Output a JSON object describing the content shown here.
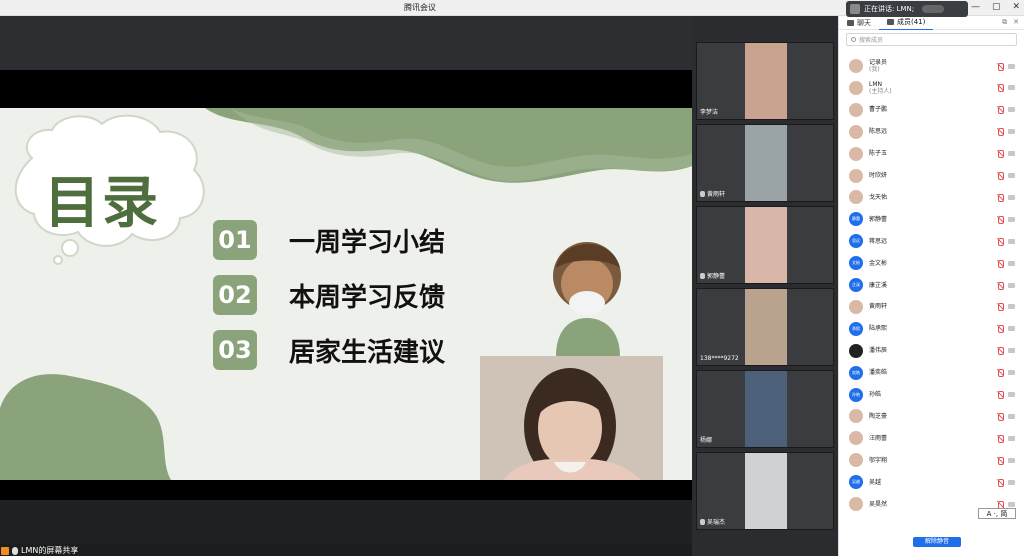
{
  "window": {
    "title": "腾讯会议",
    "controls": [
      "—",
      "▢",
      "✕"
    ]
  },
  "toast": {
    "label": "正在讲话: LMN;"
  },
  "slide": {
    "title": "目录",
    "items": [
      {
        "num": "01",
        "text": "一周学习小结"
      },
      {
        "num": "02",
        "text": "本周学习反馈"
      },
      {
        "num": "03",
        "text": "居家生活建议"
      }
    ]
  },
  "share_label": "LMN的屏幕共享",
  "videos": [
    {
      "name": "李梦洁",
      "tone": "#c9a390"
    },
    {
      "name": "黄雨轩",
      "tone": "#9aa3a6"
    },
    {
      "name": "郭静蕾",
      "tone": "#d8b6a8"
    },
    {
      "name": "138****9272",
      "tone": "#b9a38f"
    },
    {
      "name": "杨娜",
      "tone": "#4c6079"
    },
    {
      "name": "吴瑞杰",
      "tone": "#cfd1d3"
    }
  ],
  "panel": {
    "tab_chat": "聊天",
    "tab_members": "成员(41)",
    "search_placeholder": "搜索成员",
    "members": [
      {
        "name": "记录员",
        "sub": "(我)",
        "avatar": "photo"
      },
      {
        "name": "LMN",
        "sub": "(主持人)",
        "avatar": "photo"
      },
      {
        "name": "曹子鹏",
        "sub": "",
        "avatar": "photo"
      },
      {
        "name": "陈思远",
        "sub": "",
        "avatar": "photo"
      },
      {
        "name": "陈子玉",
        "sub": "",
        "avatar": "photo"
      },
      {
        "name": "时欣妍",
        "sub": "",
        "avatar": "photo"
      },
      {
        "name": "戈天佑",
        "sub": "",
        "avatar": "photo"
      },
      {
        "name": "郭静蕾",
        "sub": "",
        "avatar": "blue",
        "initials": "静蕾"
      },
      {
        "name": "蒋思远",
        "sub": "",
        "avatar": "blue",
        "initials": "思远"
      },
      {
        "name": "金文彬",
        "sub": "",
        "avatar": "blue",
        "initials": "文彬"
      },
      {
        "name": "康芷溪",
        "sub": "",
        "avatar": "blue",
        "initials": "芷溪"
      },
      {
        "name": "黄雨轩",
        "sub": "",
        "avatar": "photo"
      },
      {
        "name": "陆承熙",
        "sub": "",
        "avatar": "blue",
        "initials": "承熙"
      },
      {
        "name": "潘伟辰",
        "sub": "",
        "avatar": "dark"
      },
      {
        "name": "潘奕皓",
        "sub": "",
        "avatar": "blue",
        "initials": "奕皓"
      },
      {
        "name": "孙皓",
        "sub": "",
        "avatar": "blue",
        "initials": "孙皓"
      },
      {
        "name": "陶芝豪",
        "sub": "",
        "avatar": "photo"
      },
      {
        "name": "汪雨蕾",
        "sub": "",
        "avatar": "photo"
      },
      {
        "name": "邬宇翔",
        "sub": "",
        "avatar": "photo"
      },
      {
        "name": "吴越",
        "sub": "",
        "avatar": "blue",
        "initials": "吴越"
      },
      {
        "name": "吴昊然",
        "sub": "",
        "avatar": "photo"
      }
    ],
    "unmute_button": "解除静音"
  },
  "ime": {
    "label": "A ·, 简"
  }
}
